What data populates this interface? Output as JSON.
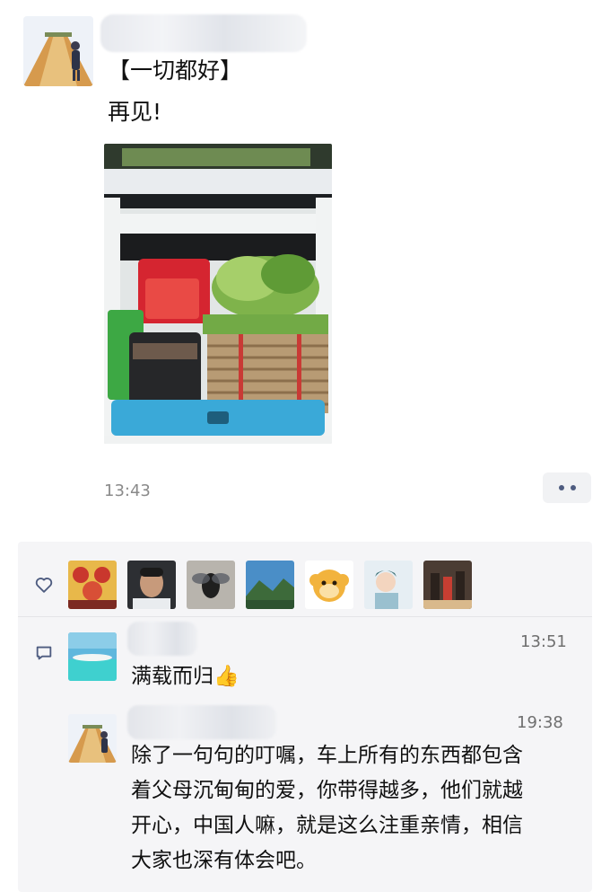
{
  "post": {
    "lines": [
      "【一切都好】",
      "再见!"
    ],
    "time": "13:43"
  },
  "likes": {
    "avatars": [
      "avatar-1",
      "avatar-2",
      "avatar-3",
      "avatar-4",
      "avatar-5",
      "avatar-6",
      "avatar-7"
    ]
  },
  "comments": [
    {
      "text": "满载而归👍",
      "time": "13:51"
    },
    {
      "text_lines": [
        "除了一句句的叮嘱，车上所有的东西都包含",
        "着父母沉甸甸的爱，你带得越多，他们就越",
        "开心，中国人嘛，就是这么注重亲情，相信",
        "大家也深有体会吧。"
      ],
      "time": "19:38"
    }
  ],
  "icons": {
    "like": "heart-outline-icon",
    "comment": "comment-bubble-icon",
    "more": "more-dots-icon"
  },
  "colors": {
    "link_dots": "#4e5c80",
    "panel_bg": "#f5f5f7",
    "meta_text": "#8a8a8a"
  }
}
